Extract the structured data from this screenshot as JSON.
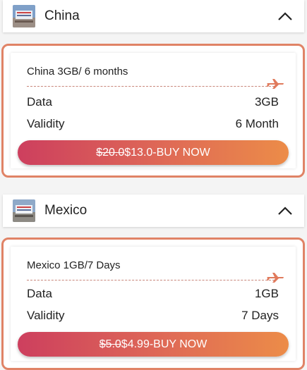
{
  "sections": [
    {
      "country": "China",
      "plan_title": "China 3GB/ 6 months",
      "data_label": "Data",
      "data_value": "3GB",
      "validity_label": "Validity",
      "validity_value": "6 Month",
      "old_price": "$20.0",
      "new_price": "$13.0",
      "buy_label": "-BUY NOW"
    },
    {
      "country": "Mexico",
      "plan_title": "Mexico 1GB/7 Days",
      "data_label": "Data",
      "data_value": "1GB",
      "validity_label": "Validity",
      "validity_value": "7 Days",
      "old_price": "$5.0",
      "new_price": "$4.99",
      "buy_label": "-BUY NOW"
    }
  ],
  "colors": {
    "card_border": "#e08366",
    "button_start": "#cd3f5e",
    "button_end": "#ec8c48",
    "plane": "#e07a5c"
  },
  "icons": {
    "collapse": "chevron-up-icon",
    "route": "airplane-icon",
    "flag": "flag-icon"
  }
}
